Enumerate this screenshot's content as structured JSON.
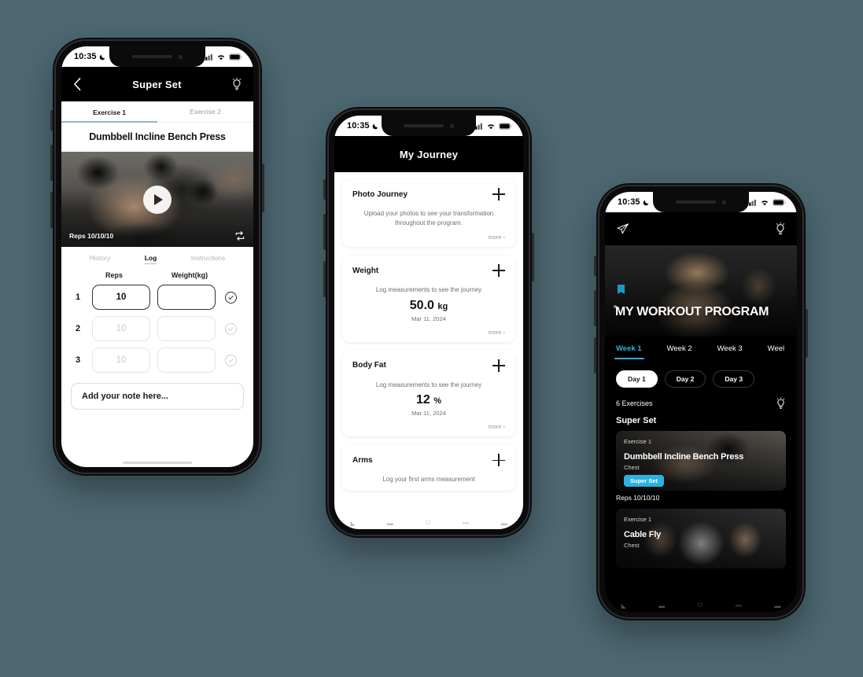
{
  "background_color": "#4d6872",
  "accent_color": "#2bb2e0",
  "status_bar": {
    "time": "10:35",
    "moon_icon": "crescent-moon-icon",
    "signal_icon": "cellular-signal-icon",
    "wifi_icon": "wifi-icon",
    "battery_icon": "battery-icon"
  },
  "phone1": {
    "header": {
      "back_icon": "chevron-left-icon",
      "title": "Super Set",
      "bulb_icon": "lightbulb-icon"
    },
    "exercise_tabs": [
      {
        "label": "Exercise 1",
        "active": true
      },
      {
        "label": "Exercise 2",
        "active": false
      }
    ],
    "exercise_name": "Dumbbell Incline Bench Press",
    "video": {
      "play_icon": "play-button-icon",
      "reps_label": "Reps 10/10/10",
      "loop_icon": "repeat-icon"
    },
    "log_tabs": [
      {
        "label": "History",
        "active": false
      },
      {
        "label": "Log",
        "active": true
      },
      {
        "label": "Instructions",
        "active": false
      }
    ],
    "columns": {
      "reps": "Reps",
      "weight": "Weight(kg)"
    },
    "sets": [
      {
        "index": "1",
        "reps_value": "10",
        "reps_placeholder": "10",
        "weight_value": "",
        "weight_placeholder": "",
        "filled": true,
        "checked": true
      },
      {
        "index": "2",
        "reps_value": "",
        "reps_placeholder": "10",
        "weight_value": "",
        "weight_placeholder": "",
        "filled": false,
        "checked": false
      },
      {
        "index": "3",
        "reps_value": "",
        "reps_placeholder": "10",
        "weight_value": "",
        "weight_placeholder": "",
        "filled": false,
        "checked": false
      }
    ],
    "note_placeholder": "Add your note here..."
  },
  "phone2": {
    "header": {
      "title": "My Journey"
    },
    "cards": [
      {
        "title": "Photo Journey",
        "add_icon": "plus-icon",
        "subtitle": "Upload your photos to see your transformation throughout the program.",
        "value": "",
        "unit": "",
        "date": "",
        "more": "more ›"
      },
      {
        "title": "Weight",
        "add_icon": "plus-icon",
        "subtitle": "Log measurements to see the journey",
        "value": "50.0",
        "unit": "kg",
        "date": "Mar 11, 2024",
        "more": "more ›"
      },
      {
        "title": "Body Fat",
        "add_icon": "plus-icon",
        "subtitle": "Log measurements to see the journey",
        "value": "12",
        "unit": "%",
        "date": "Mar 11, 2024",
        "more": "more ›"
      },
      {
        "title": "Arms",
        "add_icon": "plus-icon",
        "subtitle": "Log your first arms measurement",
        "value": "",
        "unit": "",
        "date": "",
        "more": ""
      }
    ]
  },
  "phone3": {
    "header": {
      "send_icon": "paper-plane-icon",
      "bulb_icon": "lightbulb-icon"
    },
    "hero_title": "MY WORKOUT PROGRAM",
    "weeks": [
      {
        "label": "Week 1",
        "active": true
      },
      {
        "label": "Week 2",
        "active": false
      },
      {
        "label": "Week 3",
        "active": false
      },
      {
        "label": "Weel",
        "active": false
      }
    ],
    "days": [
      {
        "label": "Day 1",
        "active": true
      },
      {
        "label": "Day 2",
        "active": false
      },
      {
        "label": "Day 3",
        "active": false
      }
    ],
    "exercise_count": "6 Exercises",
    "bulb_icon": "lightbulb-icon",
    "section_title": "Super Set",
    "exercises": [
      {
        "label": "Exercise 1",
        "name": "Dumbbell Incline Bench Press",
        "muscle": "Chest",
        "badge": "Super Set",
        "reps": "Reps 10/10/10"
      },
      {
        "label": "Exercise 1",
        "name": "Cable Fly",
        "muscle": "Chest",
        "badge": "",
        "reps": ""
      }
    ]
  }
}
